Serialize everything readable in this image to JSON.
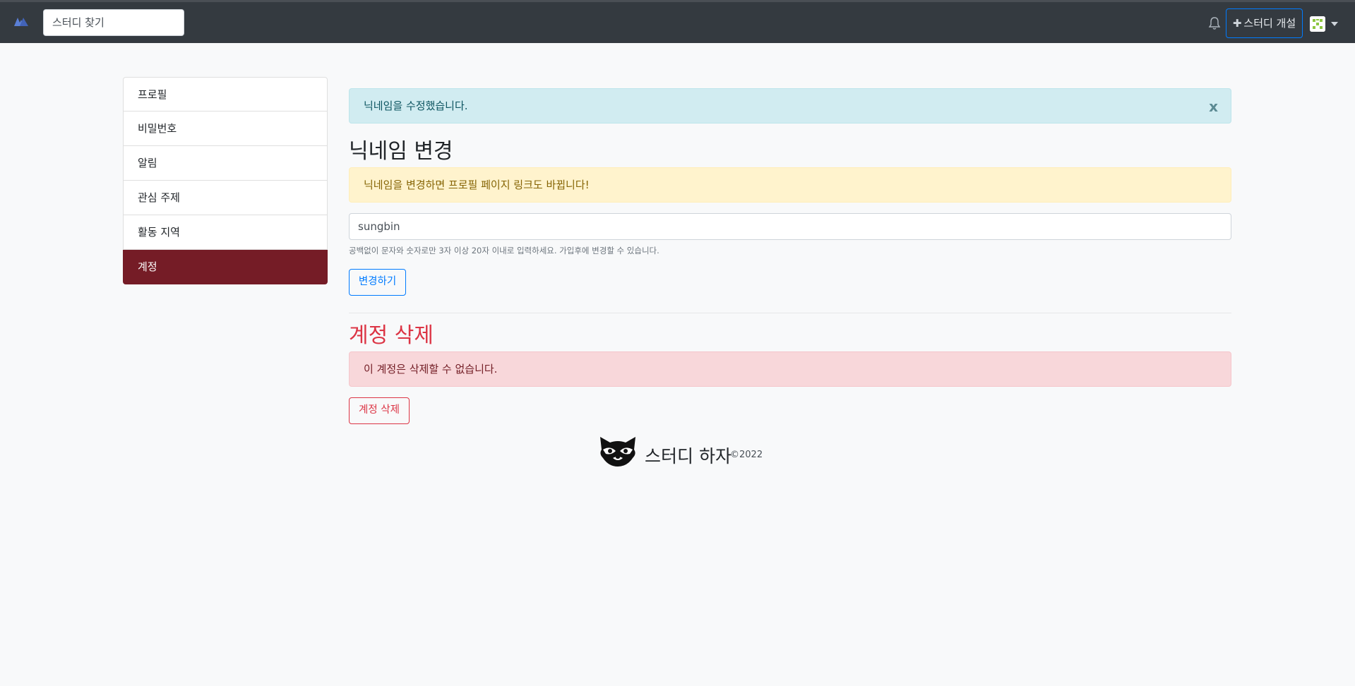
{
  "navbar": {
    "search_value": "스터디 찾기",
    "create_label": "스터디 개설",
    "brand_icon": "mountain-logo-icon",
    "notification_icon": "bell-icon"
  },
  "sidebar": {
    "items": [
      {
        "label": "프로필"
      },
      {
        "label": "비밀번호"
      },
      {
        "label": "알림"
      },
      {
        "label": "관심 주제"
      },
      {
        "label": "활동 지역"
      },
      {
        "label": "계정",
        "active": true
      }
    ]
  },
  "main": {
    "success_alert": "닉네임을 수정했습니다.",
    "close_label": "x",
    "nickname_heading": "닉네임 변경",
    "nickname_warning": "닉네임을 변경하면 프로필 페이지 링크도 바뀝니다!",
    "nickname_value": "sungbin",
    "nickname_help": "공백없이 문자와 숫자로만 3자 이상 20자 이내로 입력하세요. 가입후에 변경할 수 있습니다.",
    "change_button": "변경하기",
    "delete_heading": "계정 삭제",
    "delete_alert": "이 계정은 삭제할 수 없습니다.",
    "delete_button": "계정 삭제"
  },
  "footer": {
    "brand": "스터디 하자",
    "copyright": "©2022"
  },
  "colors": {
    "navbar": "#343a40",
    "sidebar_active": "#751c26",
    "primary": "#007bff",
    "danger": "#dc3545"
  }
}
